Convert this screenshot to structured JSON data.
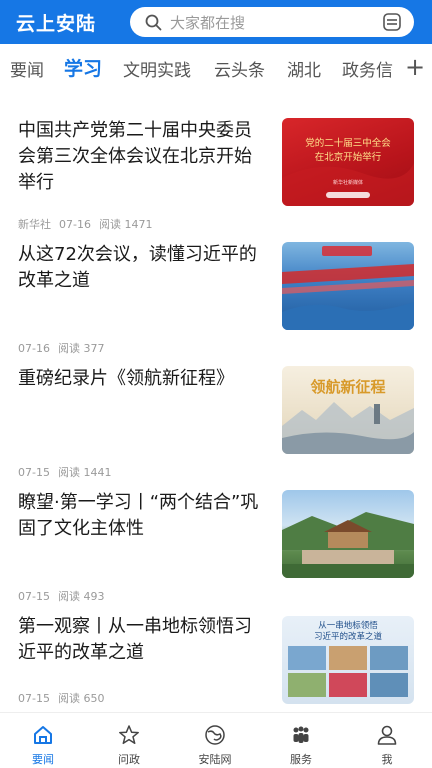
{
  "header": {
    "logo": "云上安陆",
    "search_placeholder": "大家都在搜"
  },
  "tabs": [
    {
      "label": "要闻"
    },
    {
      "label": "学习",
      "active": true
    },
    {
      "label": "文明实践"
    },
    {
      "label": "云头条"
    },
    {
      "label": "湖北"
    },
    {
      "label": "政务信"
    }
  ],
  "tabs_more": "+",
  "feed": [
    {
      "title": "中国共产党第二十届中央委员会第三次全体会议在北京开始举行",
      "source": "新华社",
      "date": "07-16",
      "reads": "阅读 1471",
      "thumb_text_1": "党的二十届三中全会",
      "thumb_text_2": "在北京开始举行",
      "thumb_text_3": "新华社新媒体"
    },
    {
      "title": "从这72次会议，读懂习近平的改革之道",
      "source": "",
      "date": "07-16",
      "reads": "阅读 377"
    },
    {
      "title": "重磅纪录片《领航新征程》",
      "source": "",
      "date": "07-15",
      "reads": "阅读 1441",
      "thumb_text_1": "领航新征程"
    },
    {
      "title": "瞭望·第一学习丨“两个结合”巩固了文化主体性",
      "source": "",
      "date": "07-15",
      "reads": "阅读 493"
    },
    {
      "title": "第一观察丨从一串地标领悟习近平的改革之道",
      "source": "",
      "date": "07-15",
      "reads": "阅读 650",
      "thumb_text_1": "从一串地标领悟",
      "thumb_text_2": "习近平的改革之道"
    }
  ],
  "bottom_nav": [
    {
      "label": "要闻",
      "icon": "home-icon",
      "active": true
    },
    {
      "label": "问政",
      "icon": "star-icon"
    },
    {
      "label": "安陆网",
      "icon": "globe-icon"
    },
    {
      "label": "服务",
      "icon": "people-icon"
    },
    {
      "label": "我",
      "icon": "user-icon"
    }
  ],
  "colors": {
    "brand": "#1677e5",
    "meta": "#9a9a9a"
  }
}
